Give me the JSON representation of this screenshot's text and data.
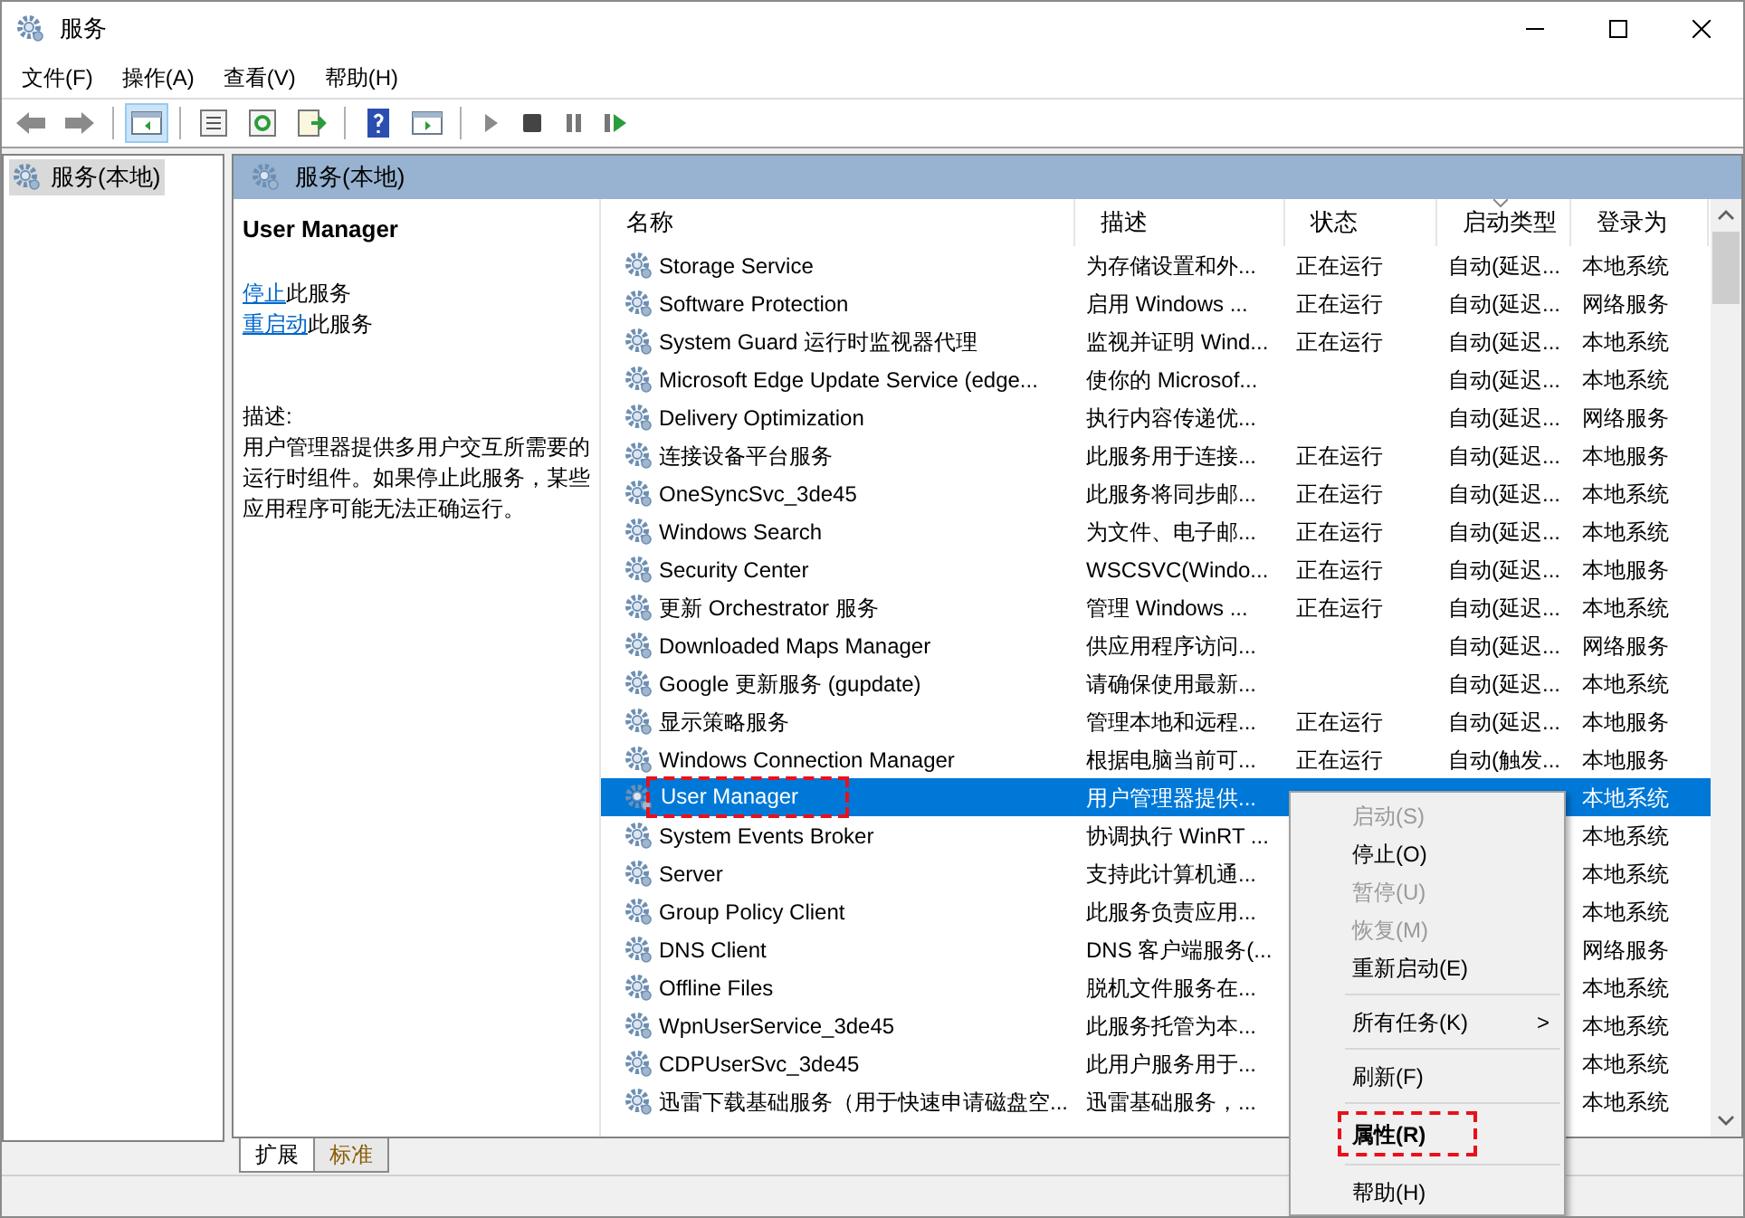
{
  "window": {
    "title": "服务"
  },
  "menu_bar": [
    "文件(F)",
    "操作(A)",
    "查看(V)",
    "帮助(H)"
  ],
  "toolbar": [
    {
      "kind": "back",
      "selected": false
    },
    {
      "kind": "forward",
      "selected": false
    },
    {
      "kind": "sep"
    },
    {
      "kind": "tree",
      "selected": true
    },
    {
      "kind": "sep"
    },
    {
      "kind": "properties",
      "selected": false
    },
    {
      "kind": "refresh",
      "selected": false
    },
    {
      "kind": "export",
      "selected": false
    },
    {
      "kind": "sep"
    },
    {
      "kind": "help",
      "selected": false
    },
    {
      "kind": "view",
      "selected": false
    },
    {
      "kind": "sep"
    },
    {
      "kind": "play",
      "selected": false
    },
    {
      "kind": "stop",
      "selected": false
    },
    {
      "kind": "pause",
      "selected": false
    },
    {
      "kind": "resume",
      "selected": false
    }
  ],
  "tree": {
    "items": [
      {
        "label": "服务(本地)",
        "selected": true
      }
    ]
  },
  "pane_header": "服务(本地)",
  "details": {
    "title": "User Manager",
    "actions": [
      {
        "link": "停止",
        "text": "此服务"
      },
      {
        "link": "重启动",
        "text": "此服务"
      }
    ],
    "description_label": "描述:",
    "description": "用户管理器提供多用户交互所需要的运行时组件。如果停止此服务，某些应用程序可能无法正确运行。"
  },
  "table": {
    "columns": [
      "名称",
      "描述",
      "状态",
      "启动类型",
      "登录为"
    ],
    "rows": [
      {
        "name": "Storage Service",
        "description": "为存储设置和外...",
        "status": "正在运行",
        "startup": "自动(延迟...",
        "logon": "本地系统",
        "selected": false
      },
      {
        "name": "Software Protection",
        "description": "启用 Windows ...",
        "status": "正在运行",
        "startup": "自动(延迟...",
        "logon": "网络服务",
        "selected": false
      },
      {
        "name": "System Guard 运行时监视器代理",
        "description": "监视并证明 Wind...",
        "status": "正在运行",
        "startup": "自动(延迟...",
        "logon": "本地系统",
        "selected": false
      },
      {
        "name": "Microsoft Edge Update Service (edge...",
        "description": "使你的 Microsof...",
        "startup": "自动(延迟...",
        "logon": "本地系统",
        "selected": false
      },
      {
        "name": "Delivery Optimization",
        "description": "执行内容传递优...",
        "startup": "自动(延迟...",
        "logon": "网络服务",
        "selected": false
      },
      {
        "name": "连接设备平台服务",
        "description": "此服务用于连接...",
        "status": "正在运行",
        "startup": "自动(延迟...",
        "logon": "本地服务",
        "selected": false
      },
      {
        "name": "OneSyncSvc_3de45",
        "description": "此服务将同步邮...",
        "status": "正在运行",
        "startup": "自动(延迟...",
        "logon": "本地系统",
        "selected": false
      },
      {
        "name": "Windows Search",
        "description": "为文件、电子邮...",
        "status": "正在运行",
        "startup": "自动(延迟...",
        "logon": "本地系统",
        "selected": false
      },
      {
        "name": "Security Center",
        "description": "WSCSVC(Windo...",
        "status": "正在运行",
        "startup": "自动(延迟...",
        "logon": "本地服务",
        "selected": false
      },
      {
        "name": "更新 Orchestrator 服务",
        "description": "管理 Windows ...",
        "status": "正在运行",
        "startup": "自动(延迟...",
        "logon": "本地系统",
        "selected": false
      },
      {
        "name": "Downloaded Maps Manager",
        "description": "供应用程序访问...",
        "startup": "自动(延迟...",
        "logon": "网络服务",
        "selected": false
      },
      {
        "name": "Google 更新服务 (gupdate)",
        "description": "请确保使用最新...",
        "startup": "自动(延迟...",
        "logon": "本地系统",
        "selected": false
      },
      {
        "name": "显示策略服务",
        "description": "管理本地和远程...",
        "status": "正在运行",
        "startup": "自动(延迟...",
        "logon": "本地服务",
        "selected": false
      },
      {
        "name": "Windows Connection Manager",
        "description": "根据电脑当前可...",
        "status": "正在运行",
        "startup": "自动(触发...",
        "logon": "本地服务",
        "selected": false
      },
      {
        "name": "User Manager",
        "description": "用户管理器提供...",
        "logon": "本地系统",
        "selected": true,
        "highlighted": true
      },
      {
        "name": "System Events Broker",
        "description": "协调执行 WinRT ...",
        "logon": "本地系统",
        "selected": false
      },
      {
        "name": "Server",
        "description": "支持此计算机通...",
        "logon": "本地系统",
        "selected": false
      },
      {
        "name": "Group Policy Client",
        "description": "此服务负责应用...",
        "logon": "本地系统",
        "selected": false
      },
      {
        "name": "DNS Client",
        "description": "DNS 客户端服务(...",
        "logon": "网络服务",
        "selected": false
      },
      {
        "name": "Offline Files",
        "description": "脱机文件服务在...",
        "logon": "本地系统",
        "selected": false
      },
      {
        "name": "WpnUserService_3de45",
        "description": "此服务托管为本...",
        "logon": "本地系统",
        "selected": false
      },
      {
        "name": "CDPUserSvc_3de45",
        "description": "此用户服务用于...",
        "logon": "本地系统",
        "selected": false
      },
      {
        "name": "迅雷下载基础服务（用于快速申请磁盘空...",
        "description": "迅雷基础服务，...",
        "logon": "本地系统",
        "selected": false
      }
    ]
  },
  "context_menu": [
    {
      "kind": "item",
      "label": "启动(S)",
      "disabled": true
    },
    {
      "kind": "item",
      "label": "停止(O)",
      "disabled": false
    },
    {
      "kind": "item",
      "label": "暂停(U)",
      "disabled": true
    },
    {
      "kind": "item",
      "label": "恢复(M)",
      "disabled": true
    },
    {
      "kind": "item",
      "label": "重新启动(E)",
      "disabled": false
    },
    {
      "kind": "separator"
    },
    {
      "kind": "submenu",
      "label": "所有任务(K)",
      "disabled": false,
      "arrow": ">"
    },
    {
      "kind": "separator"
    },
    {
      "kind": "item",
      "label": "刷新(F)",
      "disabled": false
    },
    {
      "kind": "separator"
    },
    {
      "kind": "item",
      "label": "属性(R)",
      "disabled": false,
      "bold": true,
      "highlighted": true
    },
    {
      "kind": "separator"
    },
    {
      "kind": "item",
      "label": "帮助(H)",
      "disabled": false
    }
  ],
  "bottom_tabs": [
    {
      "label": "扩展",
      "selected": true
    },
    {
      "label": "标准",
      "selected": false
    }
  ]
}
